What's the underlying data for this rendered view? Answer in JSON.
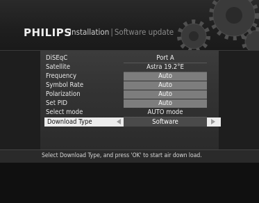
{
  "header": {
    "brand": "PHILIPS",
    "title": "Installation",
    "separator": "|",
    "subtitle": "Software update"
  },
  "settings": [
    {
      "label": "DiSEqC",
      "value": "Port A",
      "style": "plain"
    },
    {
      "label": "Satellite",
      "value": "Astra 19.2°E",
      "style": "plain"
    },
    {
      "label": "Frequency",
      "value": "Auto",
      "style": "boxed"
    },
    {
      "label": "Symbol Rate",
      "value": "Auto",
      "style": "boxed"
    },
    {
      "label": "Polarization",
      "value": "Auto",
      "style": "boxed"
    },
    {
      "label": "Set PID",
      "value": "Auto",
      "style": "boxed"
    },
    {
      "label": "Select mode",
      "value": "AUTO mode",
      "style": "plain"
    },
    {
      "label": "Download Type",
      "value": "Software",
      "style": "selected"
    }
  ],
  "help": {
    "text": "Select Download Type, and press 'OK' to start air down load."
  },
  "colors": {
    "background": "#1a1a1a",
    "panel": "#353535",
    "highlight": "#ececec",
    "value_box": "#7d7d7d"
  },
  "icons": {
    "left_arrow": "triangle-left-icon",
    "right_arrow": "triangle-right-icon",
    "decoration": "gears-icon"
  }
}
